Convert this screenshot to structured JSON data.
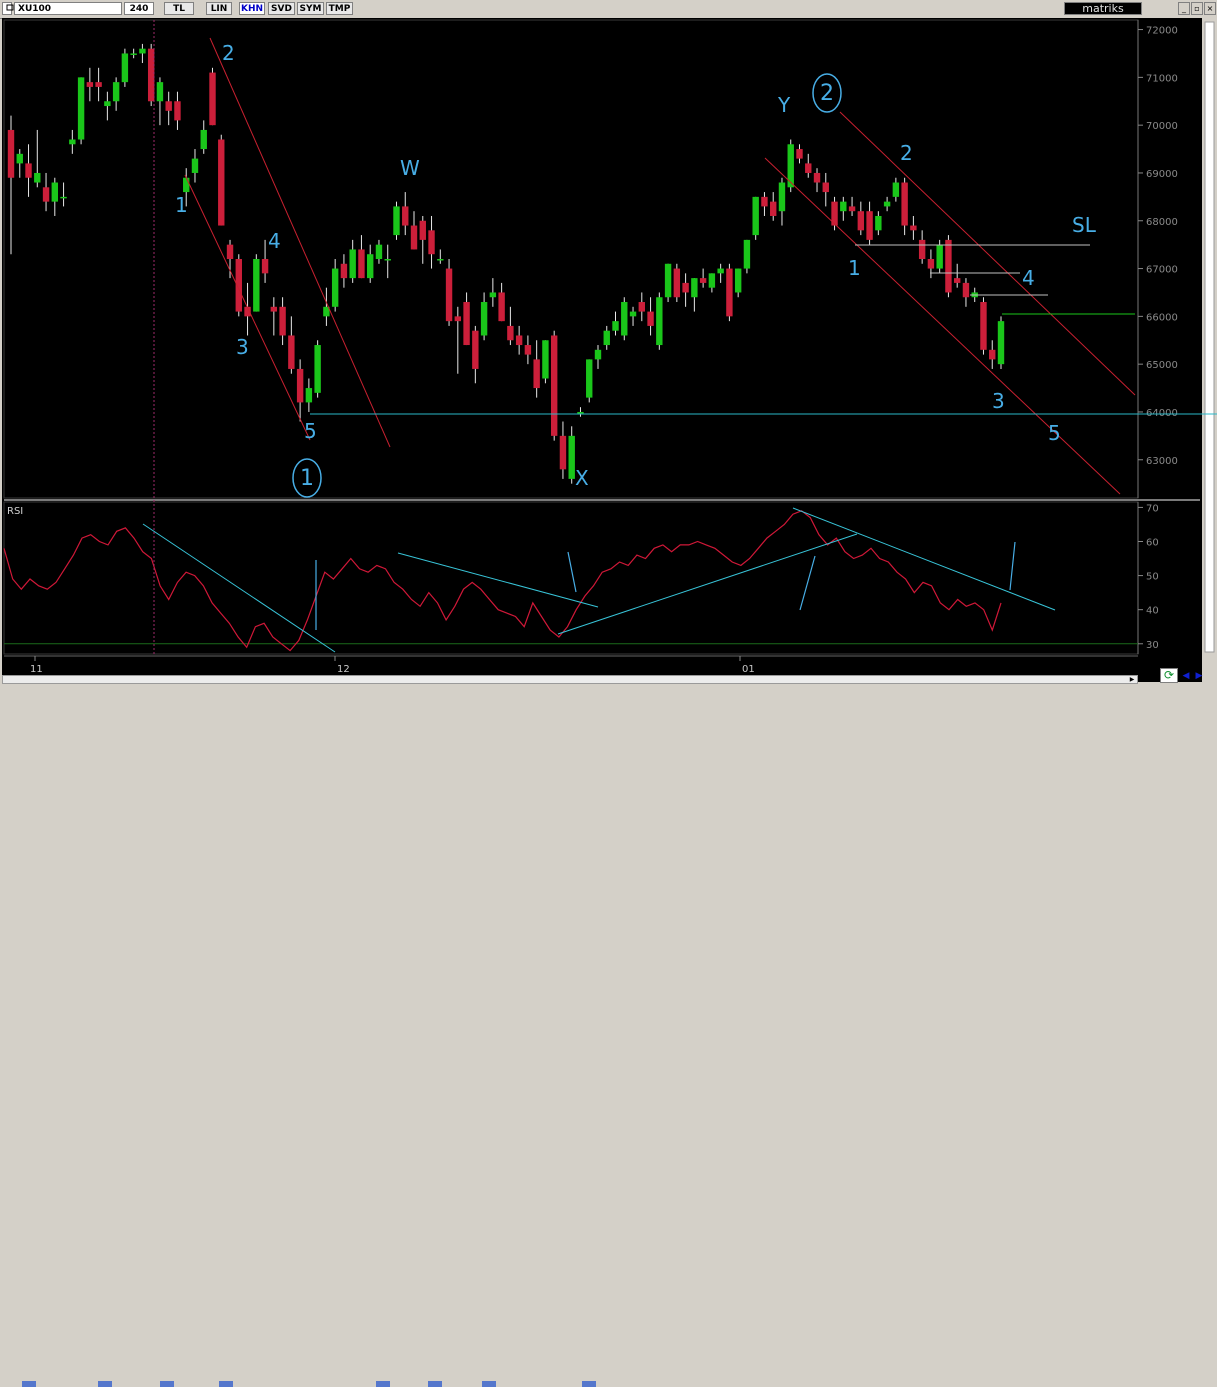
{
  "toolbar": {
    "symbol": "XU100",
    "period": "240",
    "currency": "TL",
    "buttons": [
      "TL",
      "LIN",
      "KHN",
      "SVD",
      "SYM",
      "TMP"
    ],
    "active_button": "KHN",
    "brand": "matriks"
  },
  "chart_data": [
    {
      "type": "candlestick",
      "panel": "price",
      "ylim": [
        62200,
        72200
      ],
      "y_ticks": [
        72000,
        71000,
        70000,
        69000,
        68000,
        67000,
        66000,
        65000,
        64000,
        63000
      ],
      "x_ticks": [
        "11",
        "12",
        "01"
      ],
      "candles": [
        [
          69900,
          70200,
          67300,
          68900
        ],
        [
          69200,
          69500,
          68900,
          69400
        ],
        [
          69200,
          69600,
          68500,
          68900
        ],
        [
          68800,
          69900,
          68700,
          69000
        ],
        [
          68700,
          69000,
          68200,
          68400
        ],
        [
          68400,
          68900,
          68100,
          68800
        ],
        [
          68500,
          68800,
          68300,
          68500
        ],
        [
          69600,
          69900,
          69400,
          69700
        ],
        [
          69700,
          71000,
          69600,
          71000
        ],
        [
          70900,
          71200,
          70500,
          70800
        ],
        [
          70900,
          71200,
          70500,
          70800
        ],
        [
          70400,
          70700,
          70100,
          70500
        ],
        [
          70500,
          71000,
          70300,
          70900
        ],
        [
          70900,
          71600,
          70800,
          71500
        ],
        [
          71500,
          71600,
          71400,
          71500
        ],
        [
          71500,
          71700,
          71300,
          71600
        ],
        [
          71600,
          71700,
          70400,
          70500
        ],
        [
          70500,
          71000,
          70000,
          70900
        ],
        [
          70500,
          70700,
          70000,
          70300
        ],
        [
          70500,
          70700,
          69900,
          70100
        ],
        [
          68600,
          69100,
          68300,
          68900
        ],
        [
          69000,
          69500,
          68800,
          69300
        ],
        [
          69500,
          70100,
          69400,
          69900
        ],
        [
          71100,
          71200,
          70000,
          70000
        ],
        [
          69700,
          69800,
          67900,
          67900
        ],
        [
          67500,
          67600,
          66800,
          67200
        ],
        [
          67200,
          67300,
          66000,
          66100
        ],
        [
          66200,
          66700,
          65600,
          66000
        ],
        [
          66100,
          67300,
          66100,
          67200
        ],
        [
          67200,
          67600,
          66700,
          66900
        ],
        [
          66200,
          66400,
          65600,
          66100
        ],
        [
          66200,
          66400,
          65400,
          65600
        ],
        [
          65600,
          66000,
          64800,
          64900
        ],
        [
          64900,
          65100,
          63800,
          64200
        ],
        [
          64200,
          64700,
          64000,
          64500
        ],
        [
          64400,
          65500,
          64300,
          65400
        ],
        [
          66000,
          66600,
          65800,
          66200
        ],
        [
          66200,
          67200,
          66100,
          67000
        ],
        [
          67100,
          67300,
          66600,
          66800
        ],
        [
          66800,
          67600,
          66700,
          67400
        ],
        [
          67400,
          67700,
          66800,
          66800
        ],
        [
          66800,
          67500,
          66700,
          67300
        ],
        [
          67200,
          67600,
          67100,
          67500
        ],
        [
          67200,
          67500,
          66800,
          67200
        ],
        [
          67700,
          68400,
          67600,
          68300
        ],
        [
          68300,
          68600,
          67700,
          67900
        ],
        [
          67900,
          68200,
          67400,
          67400
        ],
        [
          68000,
          68100,
          67100,
          67600
        ],
        [
          67800,
          68100,
          67000,
          67300
        ],
        [
          67200,
          67400,
          67100,
          67200
        ],
        [
          67000,
          67200,
          65800,
          65900
        ],
        [
          66000,
          66200,
          64800,
          65900
        ],
        [
          66300,
          66500,
          65400,
          65400
        ],
        [
          65700,
          65800,
          64600,
          64900
        ],
        [
          65600,
          66500,
          65500,
          66300
        ],
        [
          66400,
          66800,
          66200,
          66500
        ],
        [
          66500,
          66700,
          65900,
          65900
        ],
        [
          65800,
          66200,
          65400,
          65500
        ],
        [
          65600,
          65800,
          65200,
          65400
        ],
        [
          65400,
          65600,
          65000,
          65200
        ],
        [
          65100,
          65500,
          64300,
          64500
        ],
        [
          64700,
          65500,
          64600,
          65500
        ],
        [
          65600,
          65700,
          63400,
          63500
        ],
        [
          63500,
          63800,
          62600,
          62800
        ],
        [
          62600,
          63700,
          62500,
          63500
        ],
        [
          64000,
          64100,
          63900,
          64000
        ],
        [
          64300,
          65100,
          64200,
          65100
        ],
        [
          65100,
          65400,
          64900,
          65300
        ],
        [
          65400,
          65800,
          65300,
          65700
        ],
        [
          65700,
          66100,
          65600,
          65900
        ],
        [
          65600,
          66400,
          65500,
          66300
        ],
        [
          66000,
          66200,
          65800,
          66100
        ],
        [
          66300,
          66500,
          65900,
          66100
        ],
        [
          66100,
          66400,
          65600,
          65800
        ],
        [
          65400,
          66500,
          65300,
          66400
        ],
        [
          66400,
          67100,
          66300,
          67100
        ],
        [
          67000,
          67100,
          66300,
          66400
        ],
        [
          66700,
          66900,
          66200,
          66500
        ],
        [
          66400,
          66800,
          66100,
          66800
        ],
        [
          66800,
          67000,
          66600,
          66700
        ],
        [
          66600,
          66900,
          66500,
          66900
        ],
        [
          66900,
          67100,
          66700,
          67000
        ],
        [
          67000,
          67100,
          65900,
          66000
        ],
        [
          66500,
          67000,
          66400,
          67000
        ],
        [
          67000,
          67600,
          66900,
          67600
        ],
        [
          67700,
          68500,
          67600,
          68500
        ],
        [
          68500,
          68600,
          68100,
          68300
        ],
        [
          68400,
          68600,
          68000,
          68100
        ],
        [
          68200,
          68900,
          67900,
          68800
        ],
        [
          68700,
          69700,
          68600,
          69600
        ],
        [
          69500,
          69600,
          69200,
          69300
        ],
        [
          69200,
          69400,
          68900,
          69000
        ],
        [
          69000,
          69100,
          68600,
          68800
        ],
        [
          68800,
          69000,
          68300,
          68600
        ],
        [
          68400,
          68500,
          67800,
          67900
        ],
        [
          68200,
          68500,
          68000,
          68400
        ],
        [
          68300,
          68500,
          68100,
          68200
        ],
        [
          68200,
          68400,
          67700,
          67800
        ],
        [
          68200,
          68400,
          67500,
          67600
        ],
        [
          67800,
          68200,
          67700,
          68100
        ],
        [
          68300,
          68500,
          68200,
          68400
        ],
        [
          68500,
          68900,
          68400,
          68800
        ],
        [
          68800,
          68900,
          67700,
          67900
        ],
        [
          67900,
          68100,
          67600,
          67800
        ],
        [
          67600,
          67800,
          67100,
          67200
        ],
        [
          67200,
          67400,
          66800,
          67000
        ],
        [
          67000,
          67600,
          66900,
          67500
        ],
        [
          67600,
          67700,
          66400,
          66500
        ],
        [
          66800,
          67100,
          66600,
          66700
        ],
        [
          66700,
          66800,
          66200,
          66400
        ],
        [
          66400,
          66600,
          66300,
          66500
        ],
        [
          66300,
          66400,
          65200,
          65300
        ],
        [
          65300,
          65500,
          64900,
          65100
        ],
        [
          65000,
          66000,
          64900,
          65900
        ]
      ],
      "annotations": [
        "1",
        "2",
        "3",
        "4",
        "5",
        "1",
        "W",
        "X",
        "Y",
        "2",
        "2",
        "1",
        "3",
        "4",
        "5",
        "SL"
      ]
    },
    {
      "type": "line",
      "panel": "indicator",
      "title": "RSI",
      "ylim": [
        27,
        71
      ],
      "y_ticks": [
        70,
        60,
        50,
        40,
        30
      ],
      "series": [
        {
          "name": "RSI",
          "values": [
            58,
            49,
            46,
            49,
            47,
            46,
            48,
            52,
            56,
            61,
            62,
            60,
            59,
            63,
            64,
            61,
            57,
            55,
            47,
            43,
            48,
            51,
            50,
            47,
            42,
            39,
            36,
            32,
            29,
            35,
            36,
            32,
            30,
            28,
            31,
            37,
            44,
            51,
            49,
            52,
            55,
            52,
            51,
            53,
            52,
            48,
            46,
            43,
            41,
            45,
            42,
            37,
            41,
            46,
            48,
            46,
            43,
            40,
            39,
            38,
            35,
            42,
            38,
            34,
            32,
            35,
            40,
            44,
            47,
            51,
            52,
            54,
            53,
            56,
            55,
            58,
            59,
            57,
            59,
            59,
            60,
            59,
            58,
            56,
            54,
            53,
            55,
            58,
            61,
            63,
            65,
            68,
            69,
            67,
            62,
            59,
            61,
            57,
            55,
            56,
            58,
            55,
            54,
            51,
            49,
            45,
            48,
            47,
            42,
            40,
            43,
            41,
            42,
            40,
            34,
            42
          ]
        }
      ],
      "trendlines": 4
    }
  ],
  "colors": {
    "up_candle": "#1ac61a",
    "down_candle": "#cc1f3a",
    "price_line_color": "#ff2020",
    "rsi_line": "#d01838",
    "trendline": "#38c4d8",
    "annotation_pen": "#48aee6",
    "channel_lines": "#c82030",
    "axis_text": "#8a8a8a"
  },
  "icons": {
    "refresh": "refresh-icon",
    "nav_left": "arrow-left-icon",
    "nav_right": "arrow-right-icon"
  }
}
